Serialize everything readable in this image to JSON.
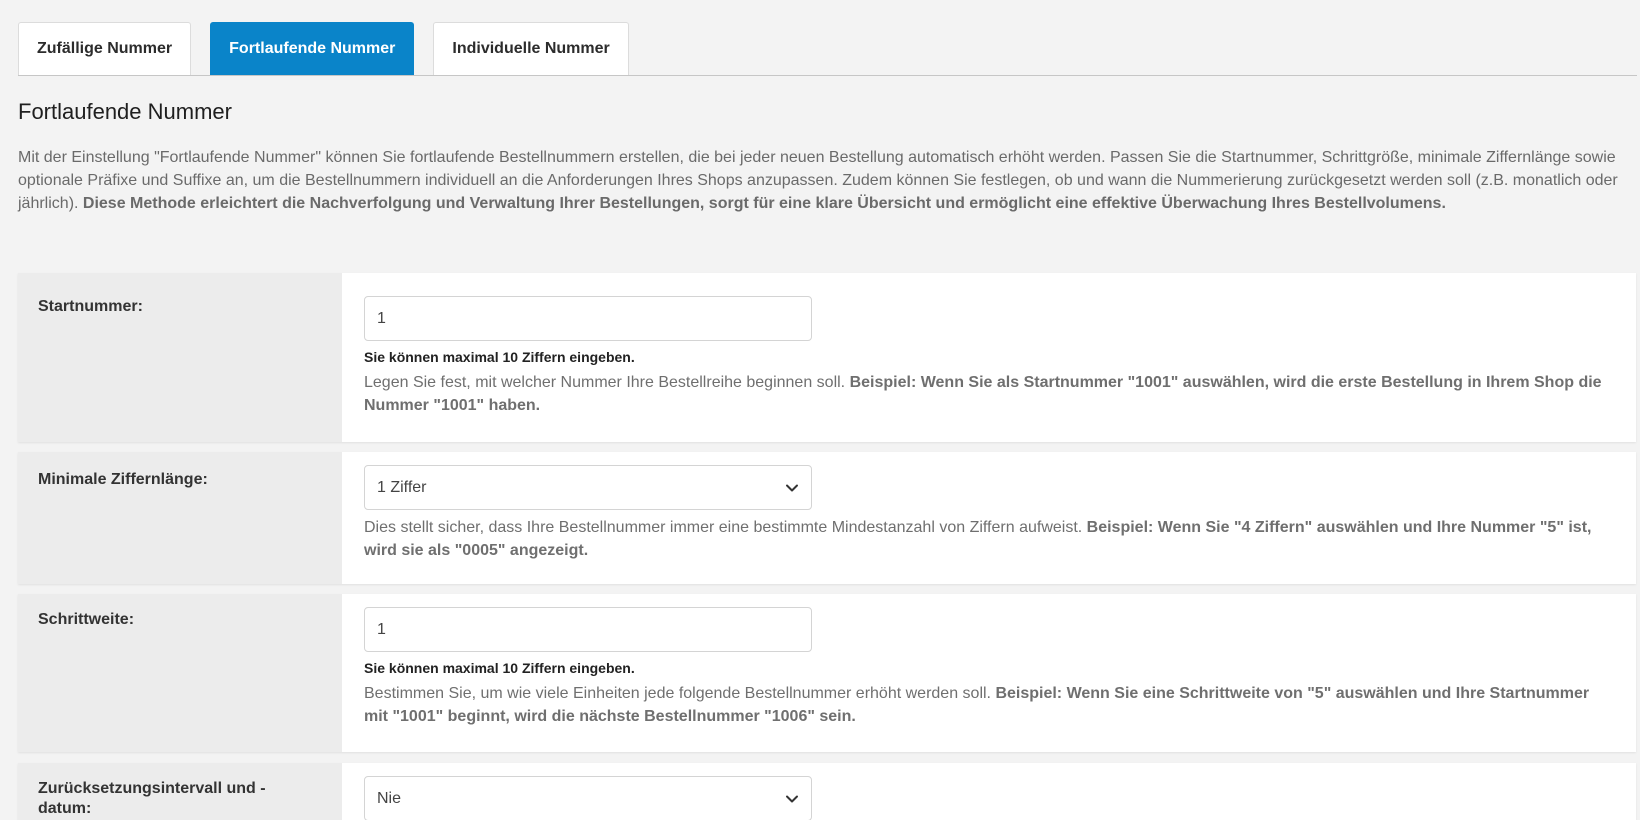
{
  "tabs": [
    {
      "label": "Zufällige Nummer",
      "active": false
    },
    {
      "label": "Fortlaufende Nummer",
      "active": true
    },
    {
      "label": "Individuelle Nummer",
      "active": false
    }
  ],
  "section": {
    "title": "Fortlaufende Nummer",
    "intro_normal": "Mit der Einstellung \"Fortlaufende Nummer\" können Sie fortlaufende Bestellnummern erstellen, die bei jeder neuen Bestellung automatisch erhöht werden. Passen Sie die Startnummer, Schrittgröße, minimale Ziffernlänge sowie optionale Präfixe und Suffixe an, um die Bestellnummern individuell an die Anforderungen Ihres Shops anzupassen. Zudem können Sie festlegen, ob und wann die Nummerierung zurückgesetzt werden soll (z.B. monatlich oder jährlich). ",
    "intro_bold": "Diese Methode erleichtert die Nachverfolgung und Verwaltung Ihrer Bestellungen, sorgt für eine klare Übersicht und ermöglicht eine effektive Überwachung Ihres Bestellvolumens."
  },
  "fields": {
    "start": {
      "label": "Startnummer:",
      "value": "1",
      "hint": "Sie können maximal 10 Ziffern eingeben.",
      "help_normal": "Legen Sie fest, mit welcher Nummer Ihre Bestellreihe beginnen soll. ",
      "help_bold": "Beispiel: Wenn Sie als Startnummer \"1001\" auswählen, wird die erste Bestellung in Ihrem Shop die Nummer \"1001\" haben."
    },
    "min_digits": {
      "label": "Minimale Ziffernlänge:",
      "selected": "1 Ziffer",
      "help_normal": "Dies stellt sicher, dass Ihre Bestellnummer immer eine bestimmte Mindestanzahl von Ziffern aufweist. ",
      "help_bold": "Beispiel: Wenn Sie \"4 Ziffern\" auswählen und Ihre Nummer \"5\" ist, wird sie als \"0005\" angezeigt."
    },
    "step": {
      "label": "Schrittweite:",
      "value": "1",
      "hint": "Sie können maximal 10 Ziffern eingeben.",
      "help_normal": "Bestimmen Sie, um wie viele Einheiten jede folgende Bestellnummer erhöht werden soll. ",
      "help_bold": "Beispiel: Wenn Sie eine Schrittweite von \"5\" auswählen und Ihre Startnummer mit \"1001\" beginnt, wird die nächste Bestellnummer \"1006\" sein."
    },
    "reset": {
      "label": "Zurücksetzungsintervall und -datum:",
      "selected": "Nie"
    }
  },
  "icons": {
    "select_chevron": "chevron-down-icon"
  },
  "colors": {
    "accent": "#0a84c9"
  }
}
